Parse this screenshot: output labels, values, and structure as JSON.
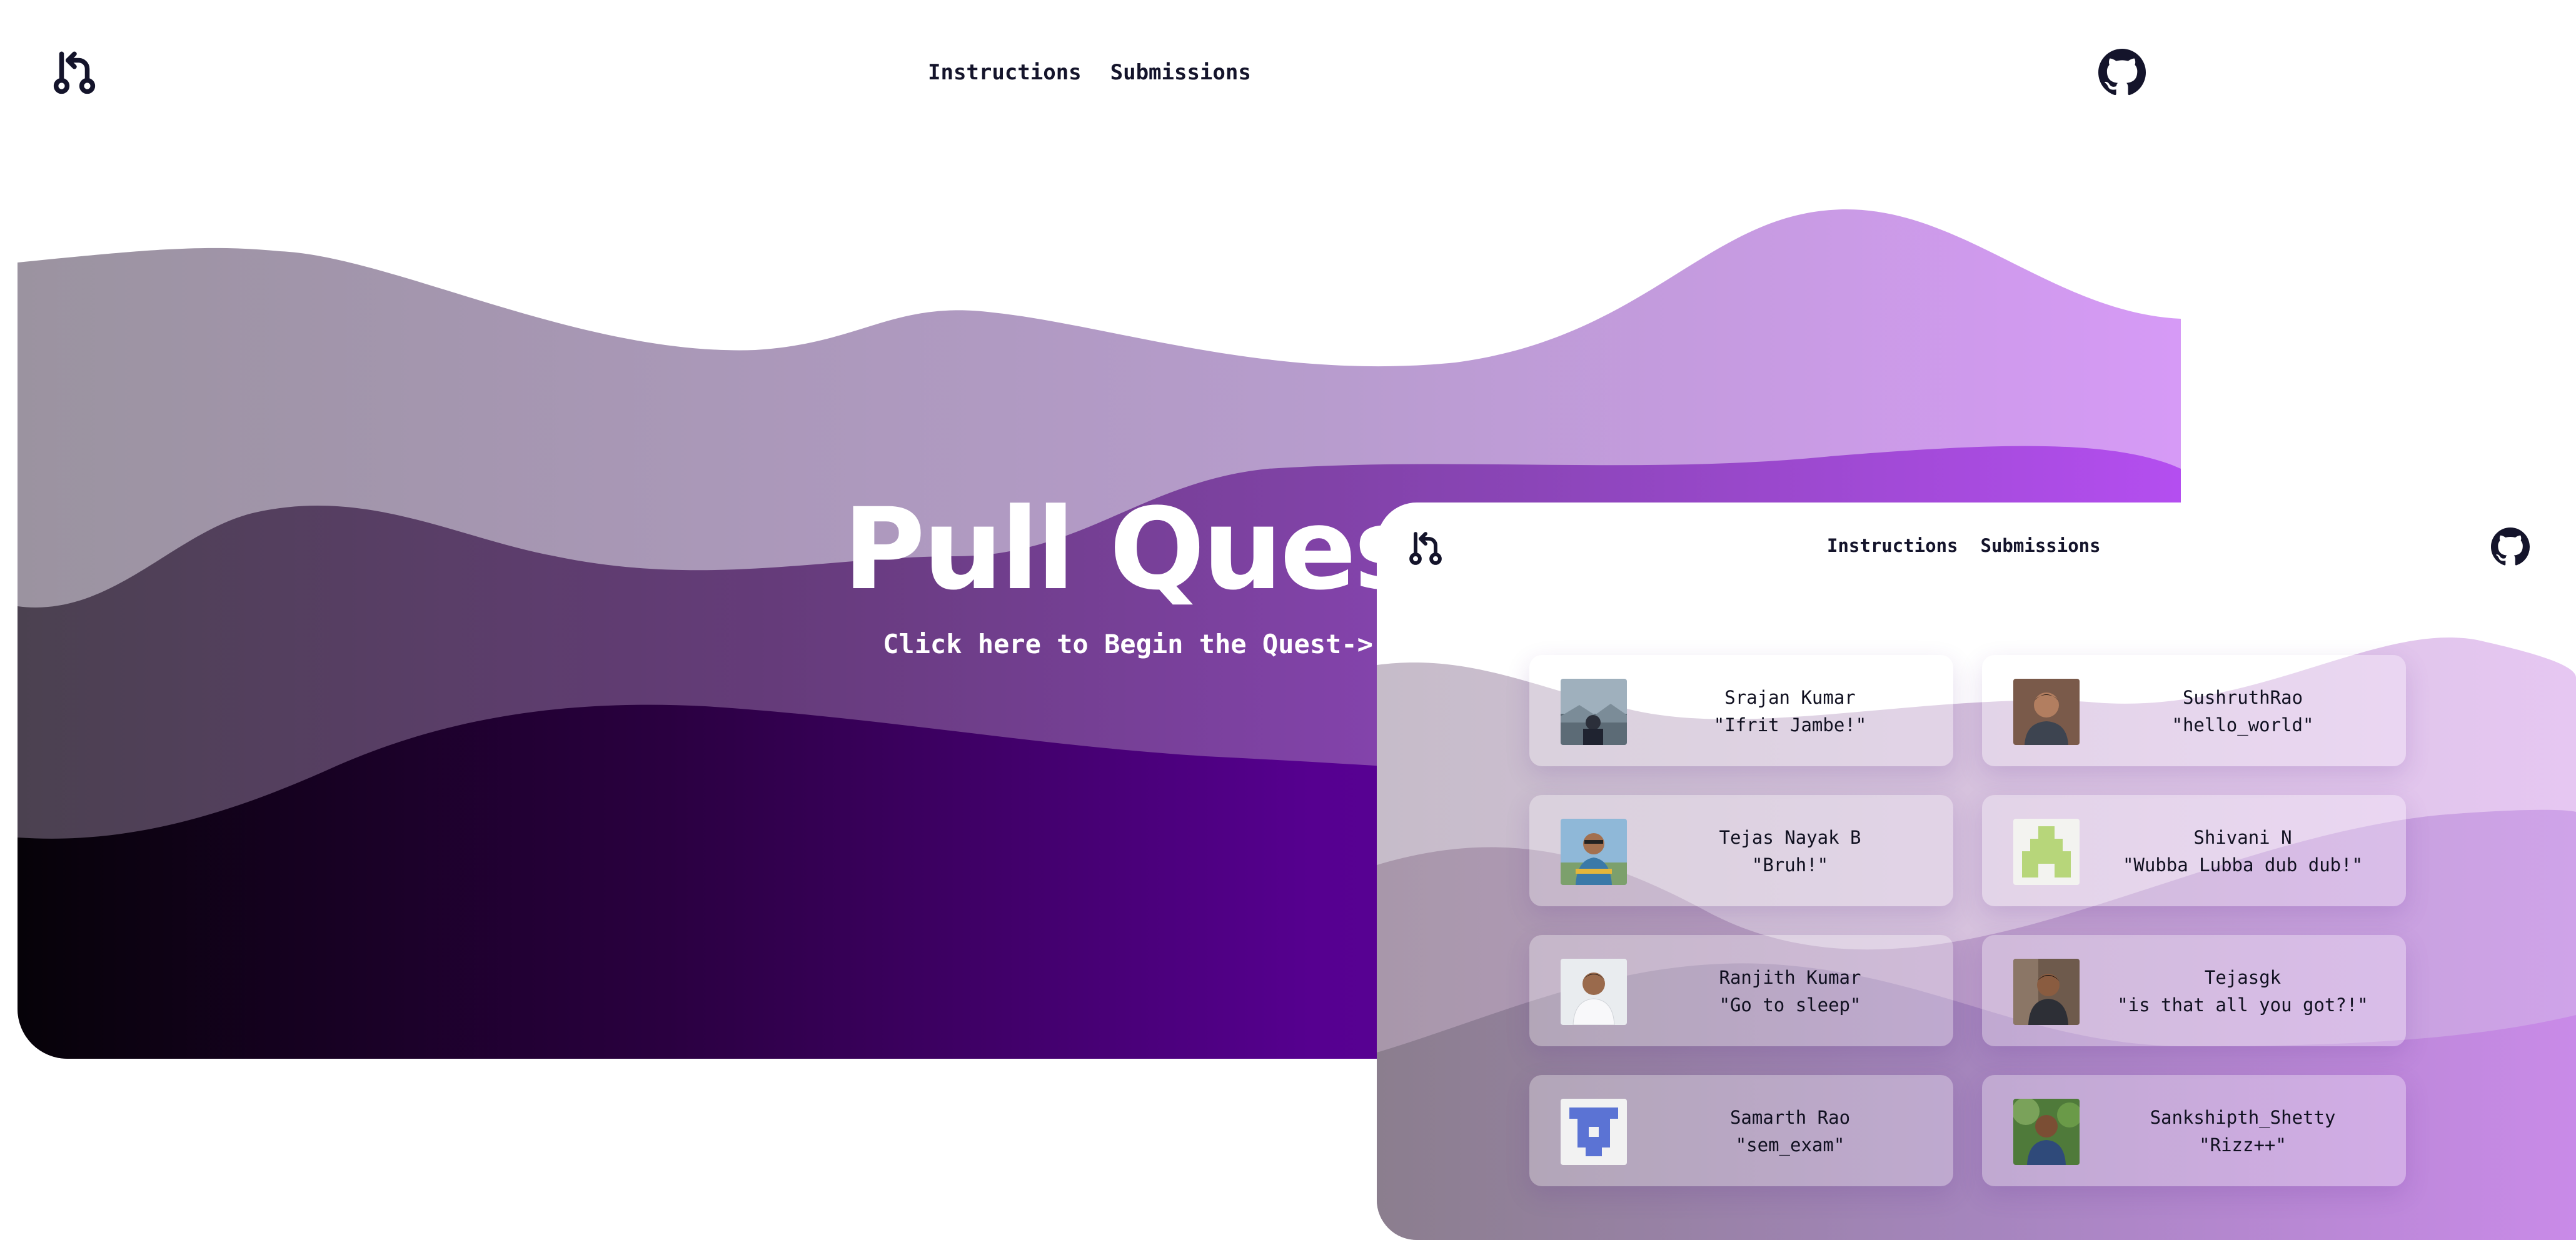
{
  "back_window": {
    "nav": {
      "instructions": "Instructions",
      "submissions": "Submissions"
    },
    "hero": {
      "title": "Pull Quest",
      "cta": "Click here to Begin the Quest->"
    }
  },
  "front_window": {
    "nav": {
      "instructions": "Instructions",
      "submissions": "Submissions"
    },
    "participants": [
      {
        "name": "Srajan Kumar",
        "quote": "\"Ifrit Jambe!\"",
        "avatar": "photo-mountain"
      },
      {
        "name": "SushruthRao",
        "quote": "\"hello_world\"",
        "avatar": "photo-person"
      },
      {
        "name": "Tejas Nayak B",
        "quote": "\"Bruh!\"",
        "avatar": "photo-outdoor"
      },
      {
        "name": "Shivani N",
        "quote": "\"Wubba Lubba dub dub!\"",
        "avatar": "identicon-green"
      },
      {
        "name": "Ranjith Kumar",
        "quote": "\"Go to sleep\"",
        "avatar": "photo-white-shirt"
      },
      {
        "name": "Tejasgk",
        "quote": "\"is that all you got?!\"",
        "avatar": "photo-person-dark"
      },
      {
        "name": "Samarth Rao",
        "quote": "\"sem_exam\"",
        "avatar": "identicon-blue"
      },
      {
        "name": "Sankshipth_Shetty",
        "quote": "\"Rizz++\"",
        "avatar": "photo-greenery"
      }
    ]
  },
  "icons": {
    "logo": "git-pull-request-icon",
    "github": "github-icon"
  },
  "colors": {
    "nav_text": "#14142b",
    "hero_text": "#ffffff",
    "purple_dark": "#4b0a86",
    "purple_light": "#d39af4",
    "identicon_green": "#b7d67a",
    "identicon_blue": "#5b73d4"
  }
}
